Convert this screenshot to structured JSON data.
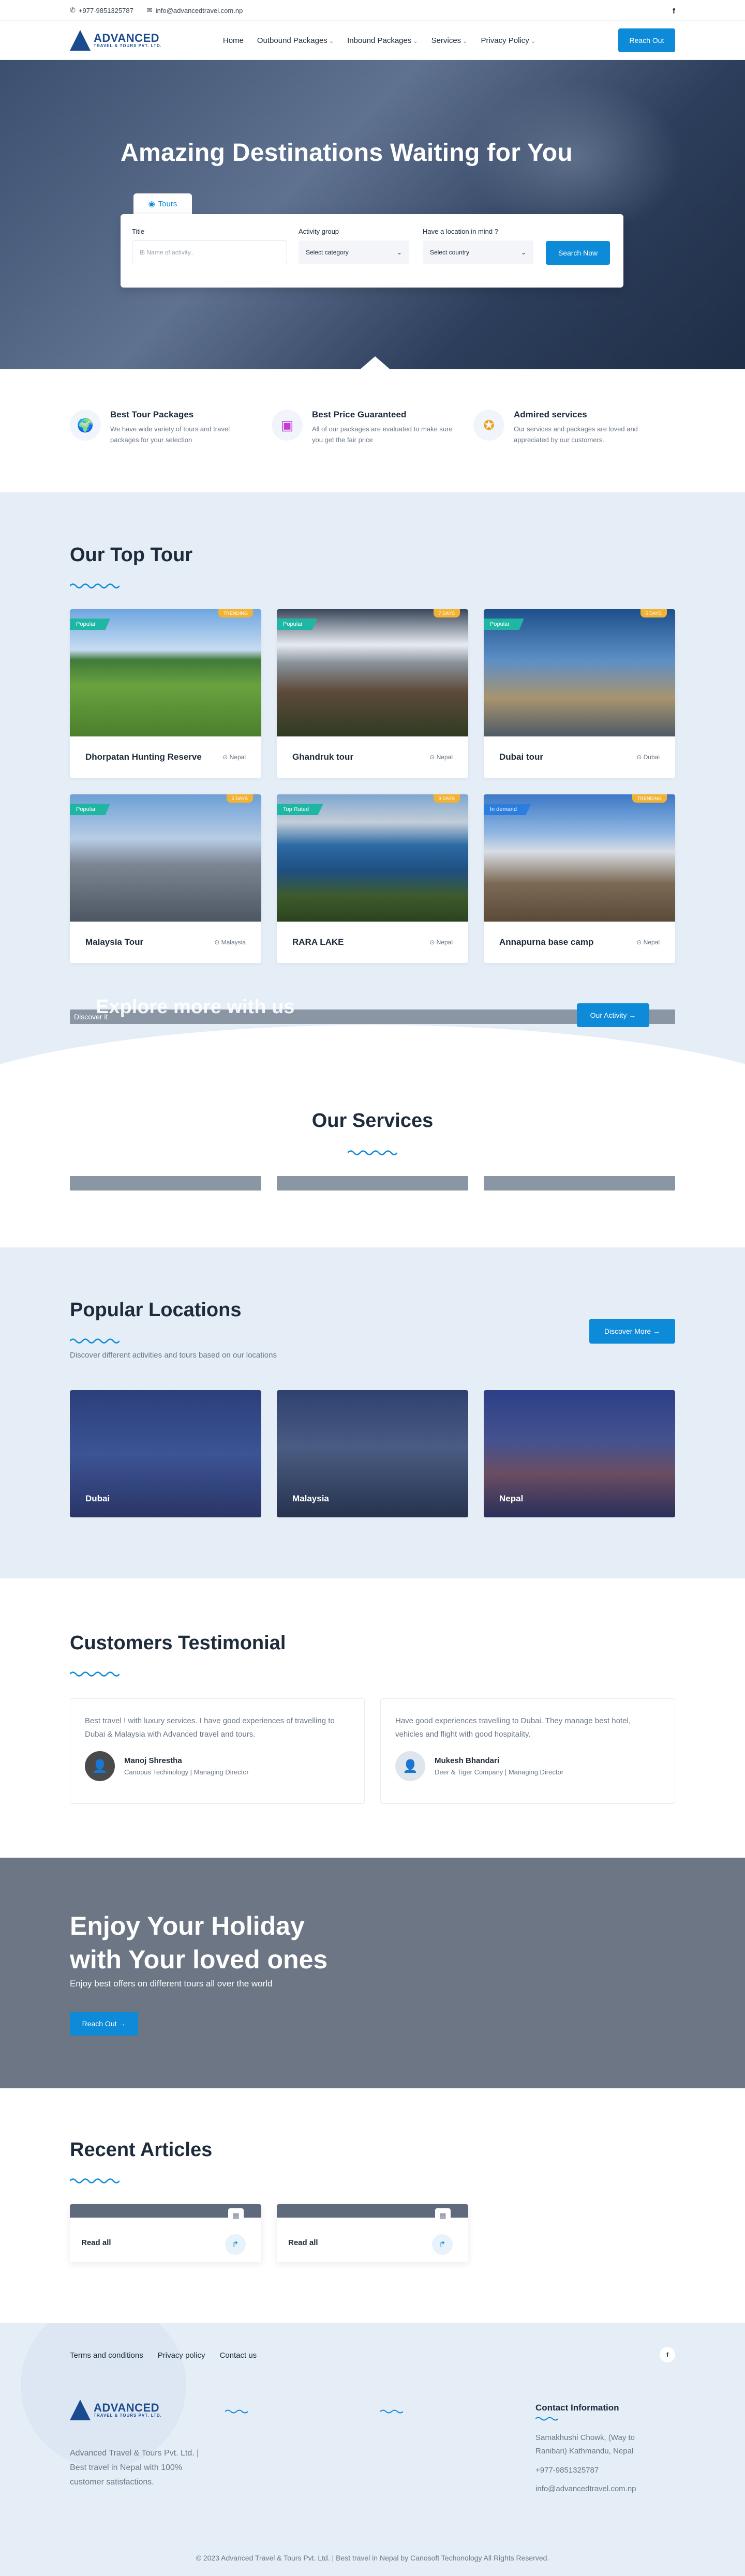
{
  "topbar": {
    "phone": "+977-9851325787",
    "email": "info@advancedtravel.com.np",
    "social_icon": "facebook-icon"
  },
  "brand": {
    "name": "ADVANCED",
    "tagline": "TRAVEL & TOURS PVT. LTD.",
    "color": "#1b4b8f"
  },
  "nav": {
    "items": [
      "Home",
      "Outbound Packages",
      "Inbound Packages",
      "Services",
      "Privacy Policy"
    ],
    "cta": "Reach Out"
  },
  "hero": {
    "title": "Amazing Destinations Waiting for You",
    "tab": "Tours",
    "title_label": "Title",
    "title_placeholder": "Name of activity..",
    "group_label": "Activity group",
    "group_value": "Select category",
    "location_label": "Have a location in mind ?",
    "location_value": "Select country",
    "search_btn": "Search Now"
  },
  "features": [
    {
      "title": "Best Tour Packages",
      "text": "We have wide variety of tours and travel packages for your selection",
      "icon": "globe-icon"
    },
    {
      "title": "Best Price Guaranteed",
      "text": "All of our packages are evaluated to make sure you get the fair price",
      "icon": "wallet-icon"
    },
    {
      "title": "Admired services",
      "text": "Our services and packages are loved and appreciated by our customers.",
      "icon": "medal-icon"
    }
  ],
  "top_tour": {
    "title": "Our Top Tour",
    "tours": [
      {
        "name": "Dhorpatan Hunting Reserve",
        "location": "Nepal",
        "flag": "Popular",
        "badge": "TRENDING"
      },
      {
        "name": "Ghandruk tour",
        "location": "Nepal",
        "flag": "Popular",
        "badge": "7 DAYS"
      },
      {
        "name": "Dubai tour",
        "location": "Dubai",
        "flag": "Popular",
        "badge": "5 DAYS"
      },
      {
        "name": "Malaysia Tour",
        "location": "Malaysia",
        "flag": "Popular",
        "badge": "5 DAYS"
      },
      {
        "name": "RARA LAKE",
        "location": "Nepal",
        "flag": "Top Rated",
        "badge": "9 DAYS"
      },
      {
        "name": "Annapurna base camp",
        "location": "Nepal",
        "flag": "In demand",
        "badge": "TRENDING"
      }
    ],
    "explore_title": "Explore more with us",
    "explore_sub": "Discover it",
    "explore_btn": "Our Activity"
  },
  "services": {
    "title": "Our Services"
  },
  "locations": {
    "title": "Popular Locations",
    "desc": "Discover different activities and tours based on our locations",
    "btn": "Discover More",
    "items": [
      "Dubai",
      "Malaysia",
      "Nepal"
    ]
  },
  "testimonials": {
    "title": "Customers Testimonial",
    "items": [
      {
        "text": "Best travel ! with luxury services. I have good experiences of travelling to Dubai & Malaysia with Advanced travel and tours.",
        "name": "Manoj Shrestha",
        "role": "Canopus Techinology | Managing Director"
      },
      {
        "text": "Have good experiences travelling to Dubai. They manage best hotel, vehicles and flight with good hospitality.",
        "name": "Mukesh Bhandari",
        "role": "Deer & Tiger Company | Managing Director"
      }
    ]
  },
  "holiday": {
    "line1": "Enjoy Your Holiday",
    "line2": "with Your loved ones",
    "desc": "Enjoy best offers on different tours all over the world",
    "btn": "Reach Out"
  },
  "articles": {
    "title": "Recent Articles",
    "read": "Read all"
  },
  "footer": {
    "links": [
      "Terms and conditions",
      "Privacy policy",
      "Contact us"
    ],
    "about": "Advanced Travel & Tours Pvt. Ltd. | Best travel in Nepal with 100% customer satisfactions.",
    "contact_title": "Contact Information",
    "address": "Samakhushi Chowk, (Way to Ranibari) Kathmandu, Nepal",
    "phone": "+977-9851325787",
    "email": "info@advancedtravel.com.np",
    "copyright": "© 2023 Advanced Travel & Tours Pvt. Ltd. | Best travel in Nepal by Canosoft Techonology All Rights Reserved."
  },
  "colors": {
    "accent": "#0d8ad8",
    "section_bg": "#e5edf7",
    "flag": "#1fb6a4",
    "badge": "#f2b233"
  }
}
